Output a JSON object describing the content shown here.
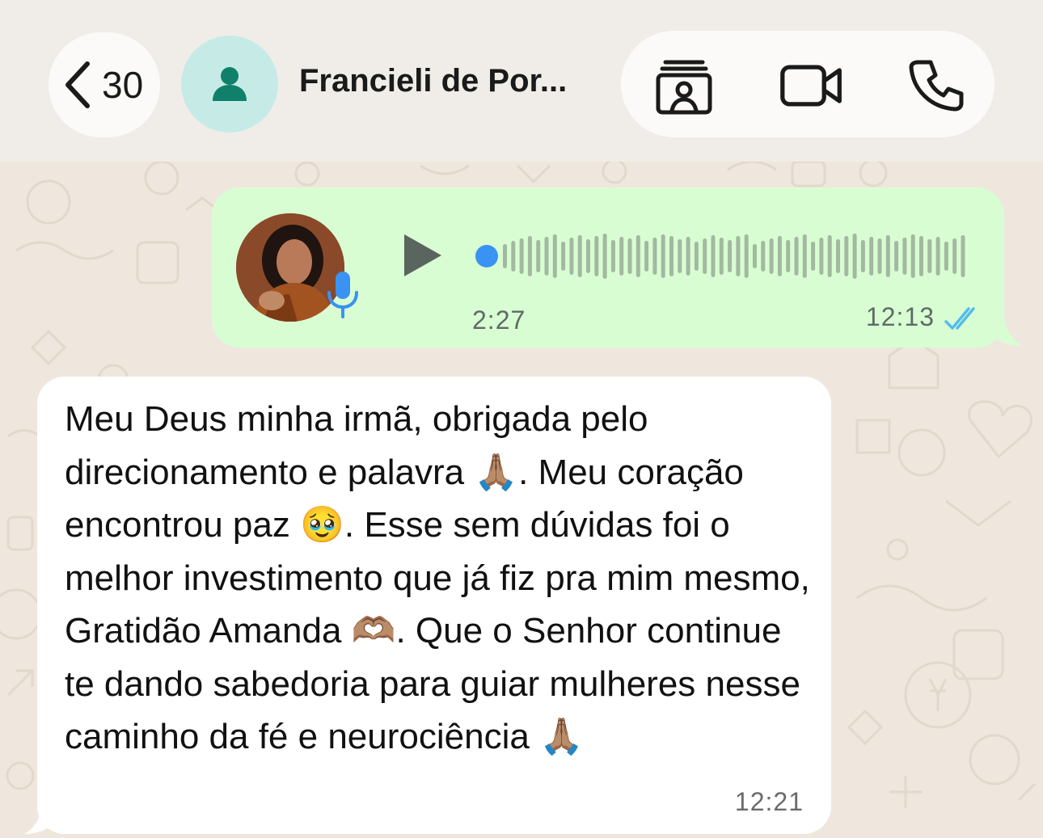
{
  "header": {
    "back_count": "30",
    "contact_name": "Francieli de Por...",
    "actions": [
      {
        "icon": "contact-card-icon"
      },
      {
        "icon": "video-camera-icon"
      },
      {
        "icon": "phone-icon"
      }
    ]
  },
  "messages": [
    {
      "type": "audio",
      "direction": "outgoing",
      "duration": "2:27",
      "time": "12:13",
      "status": "read"
    },
    {
      "type": "text",
      "direction": "incoming",
      "text": "Meu Deus minha irmã, obrigada pelo direcionamento e palavra 🙏🏽. Meu coração encontrou paz 🥹. Esse sem dúvidas foi o melhor investimento que já fiz pra mim mesmo, Gratidão Amanda 🫶🏽. Que o Senhor continue te dando sabedoria para guiar mulheres nesse caminho da fé e neurociência 🙏🏽",
      "time": "12:21"
    }
  ],
  "colors": {
    "outgoing_bubble": "#d9fdd3",
    "incoming_bubble": "#ffffff",
    "accent_teal": "#11806a",
    "read_ticks": "#53bdeb",
    "audio_progress_dot": "#3a92f2"
  }
}
